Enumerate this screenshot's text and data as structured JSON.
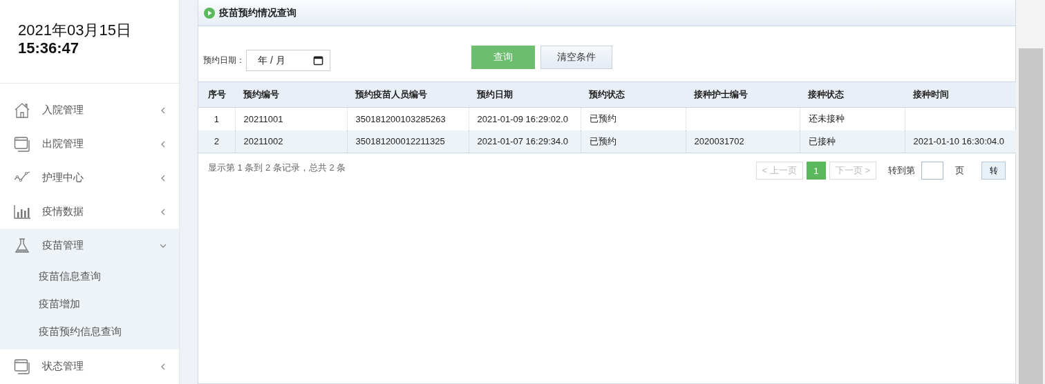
{
  "clock": {
    "date": "2021年03月15日",
    "time": "15:36:47"
  },
  "nav": [
    {
      "label": "入院管理",
      "kind": "house",
      "expanded": false
    },
    {
      "label": "出院管理",
      "kind": "windows",
      "expanded": false
    },
    {
      "label": "护理中心",
      "kind": "line",
      "expanded": false
    },
    {
      "label": "疫情数据",
      "kind": "bars",
      "expanded": false
    },
    {
      "label": "疫苗管理",
      "kind": "flask",
      "expanded": true,
      "children": [
        {
          "label": "疫苗信息查询"
        },
        {
          "label": "疫苗增加"
        },
        {
          "label": "疫苗预约信息查询"
        }
      ]
    },
    {
      "label": "状态管理",
      "kind": "windows",
      "expanded": false
    }
  ],
  "panel": {
    "title": "疫苗预约情况查询",
    "filter": {
      "label": "预约日期：",
      "placeholder": "年 / 月"
    },
    "buttons": [
      {
        "label": "查询",
        "kind": "primary"
      },
      {
        "label": "清空条件",
        "kind": "default"
      }
    ],
    "table": {
      "columns": [
        "序号",
        "预约编号",
        "预约疫苗人员编号",
        "预约日期",
        "预约状态",
        "接种护士编号",
        "接种状态",
        "接种时间"
      ],
      "rows": [
        [
          "1",
          "20211001",
          "350181200103285263",
          "2021-01-09 16:29:02.0",
          "已预约",
          "",
          "还未接种",
          ""
        ],
        [
          "2",
          "20211002",
          "350181200012211325",
          "2021-01-07 16:29:34.0",
          "已预约",
          "2020031702",
          "已接种",
          "2021-01-10 16:30:04.0"
        ]
      ]
    },
    "summary": "显示第 1 条到 2 条记录，总共 2 条",
    "pager": {
      "prev": "< 上一页",
      "pages": [
        {
          "label": "1",
          "selected": true
        }
      ],
      "next": "下一页 >",
      "goto_label": "转到第",
      "page_unit": "页",
      "go": "转"
    }
  }
}
